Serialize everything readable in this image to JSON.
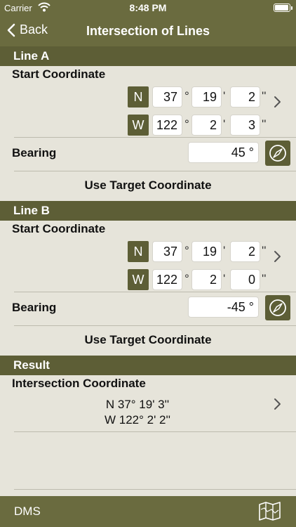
{
  "status": {
    "carrier": "Carrier",
    "time": "8:48 PM"
  },
  "nav": {
    "back_label": "Back",
    "title": "Intersection of Lines"
  },
  "line_a": {
    "header": "Line A",
    "start_label": "Start Coordinate",
    "lat": {
      "dir": "N",
      "deg": "37",
      "min": "19",
      "sec": "2"
    },
    "lon": {
      "dir": "W",
      "deg": "122",
      "min": "2",
      "sec": "3"
    },
    "bearing_label": "Bearing",
    "bearing_value": "45 °",
    "use_target": "Use Target Coordinate"
  },
  "line_b": {
    "header": "Line B",
    "start_label": "Start Coordinate",
    "lat": {
      "dir": "N",
      "deg": "37",
      "min": "19",
      "sec": "2"
    },
    "lon": {
      "dir": "W",
      "deg": "122",
      "min": "2",
      "sec": "0"
    },
    "bearing_label": "Bearing",
    "bearing_value": "-45 °",
    "use_target": "Use Target Coordinate"
  },
  "units": {
    "deg": "°",
    "min": "'",
    "sec": "''"
  },
  "result": {
    "header": "Result",
    "label": "Intersection Coordinate",
    "lat_text": "N 37° 19' 3''",
    "lon_text": "W 122° 2' 2''"
  },
  "tabbar": {
    "format_label": "DMS",
    "map_icon": "map-icon"
  },
  "colors": {
    "bar": "#6a6b3f",
    "header": "#5d5e36",
    "background": "#e6e4da"
  }
}
